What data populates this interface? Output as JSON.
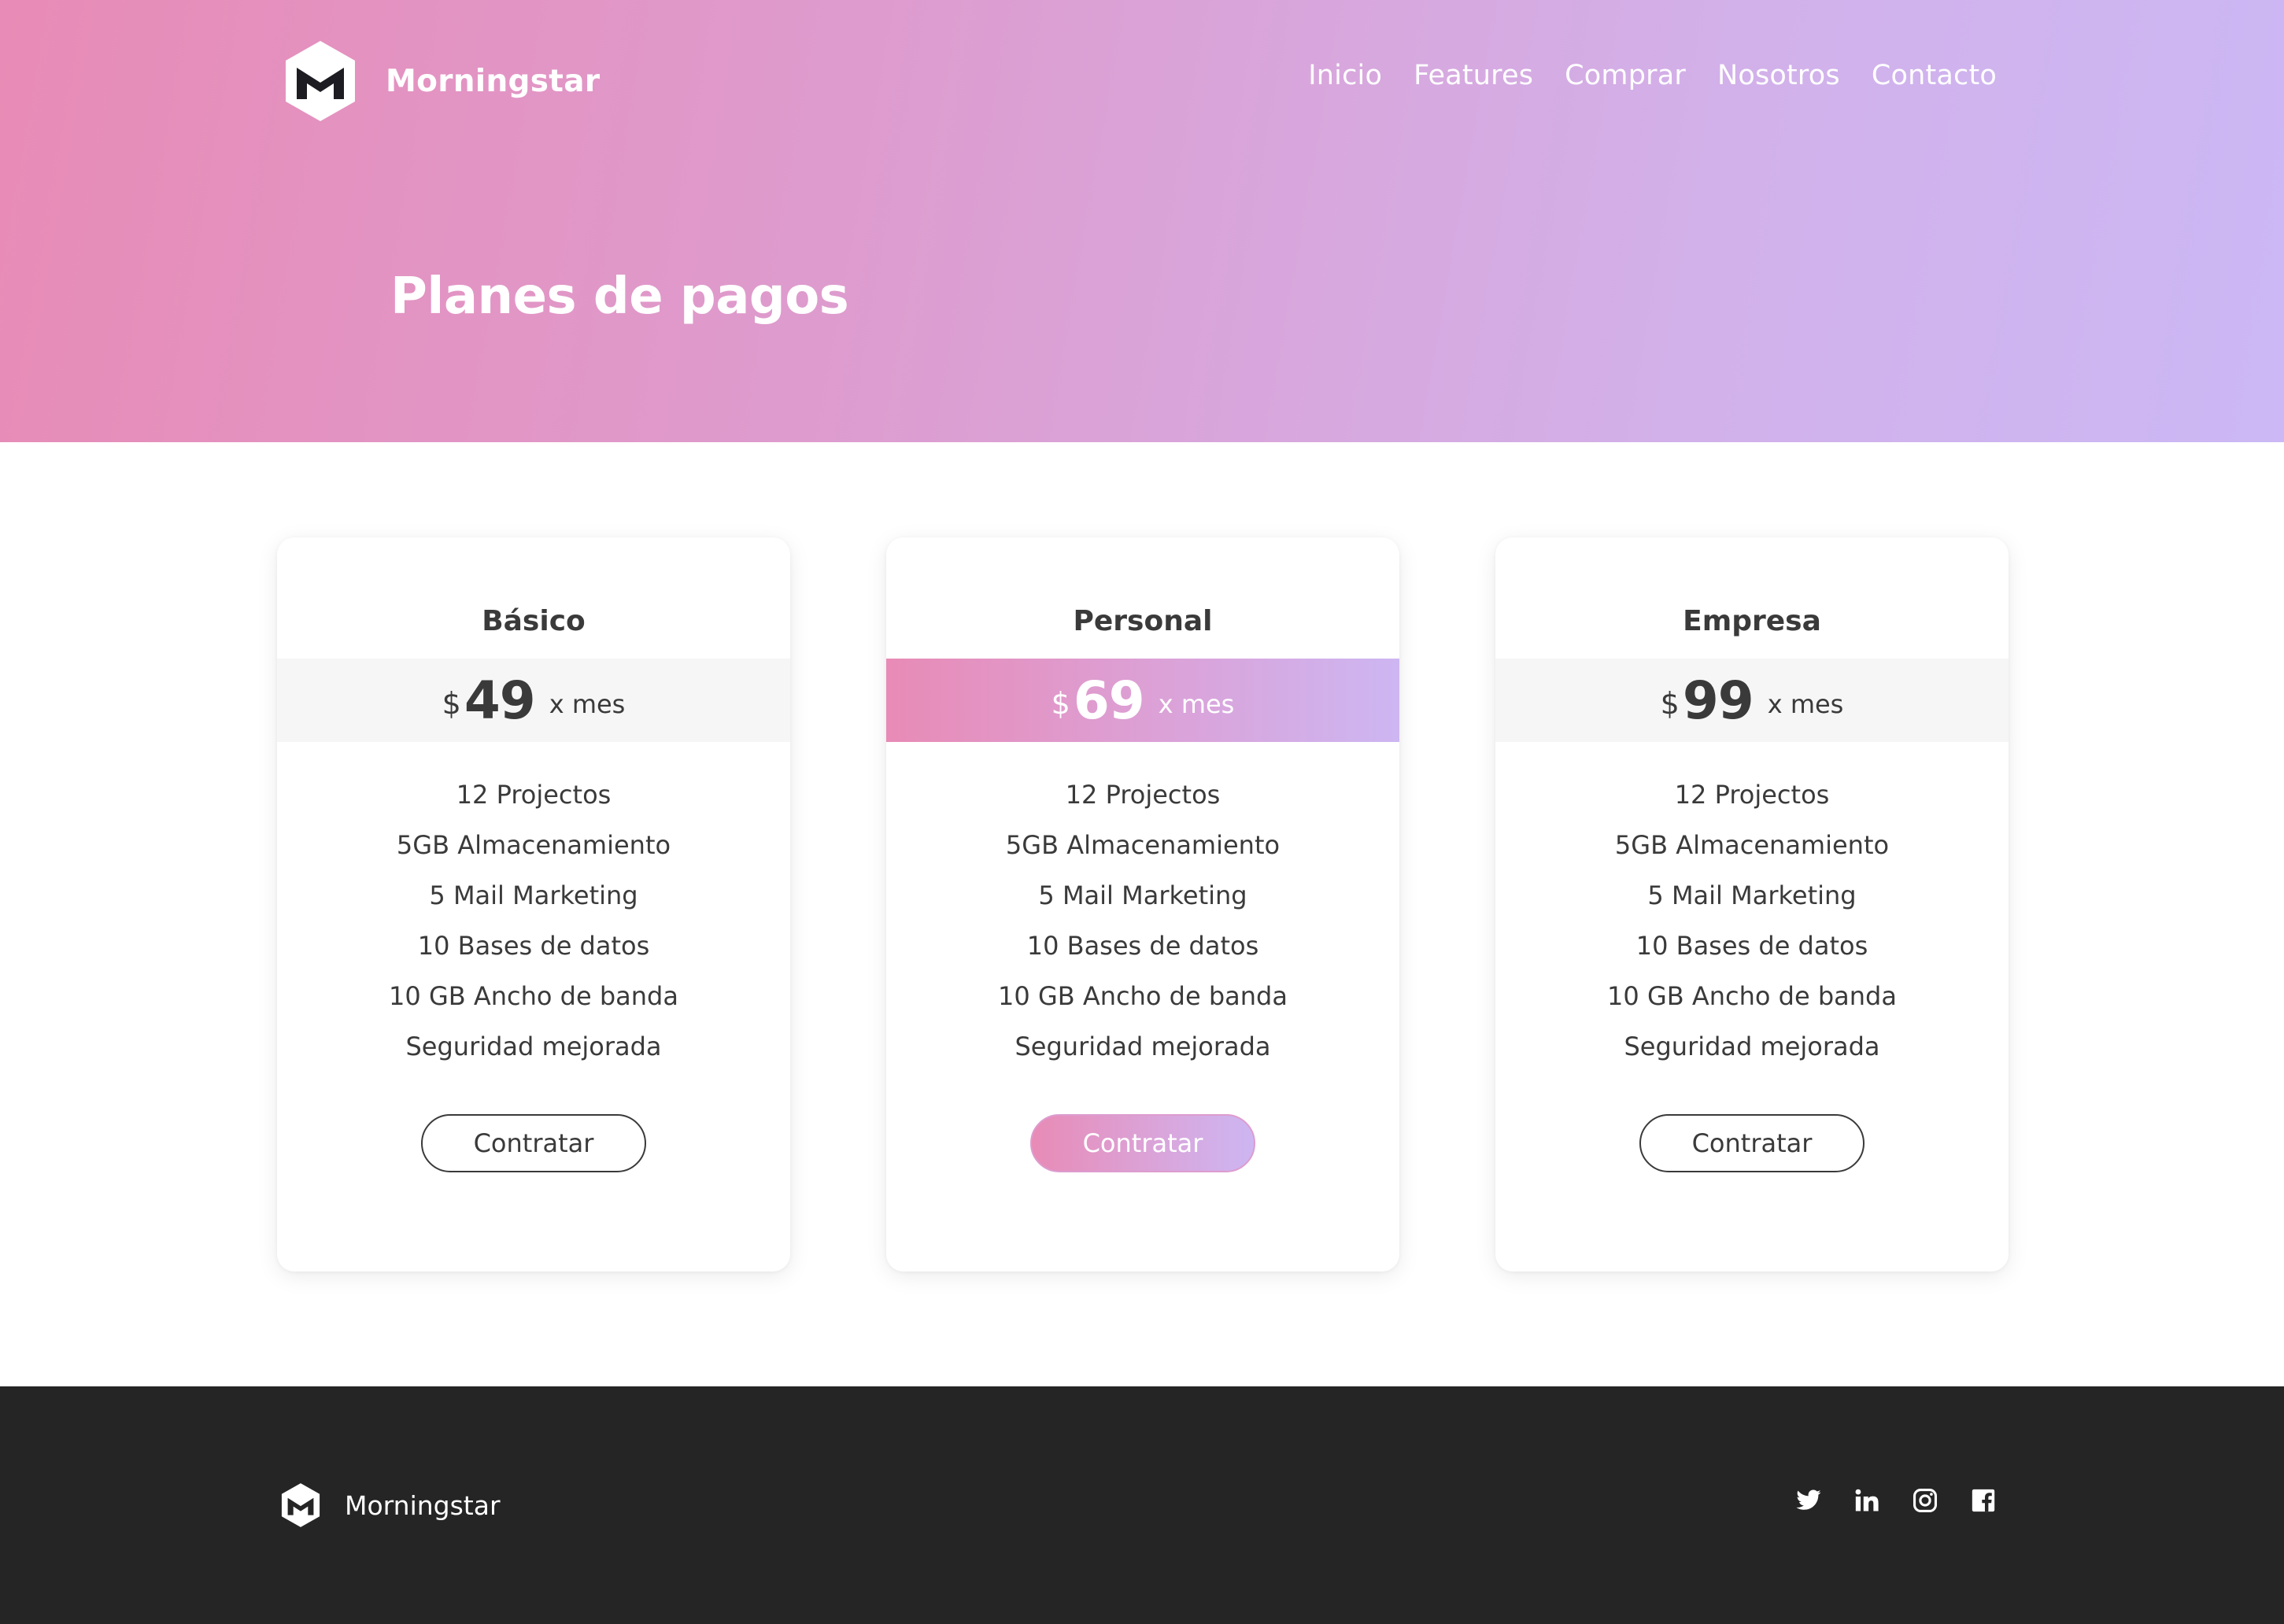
{
  "brand": {
    "name": "Morningstar"
  },
  "nav": {
    "items": [
      "Inicio",
      "Features",
      "Comprar",
      "Nosotros",
      "Contacto"
    ]
  },
  "hero": {
    "title": "Planes de pagos"
  },
  "plans": [
    {
      "name": "Básico",
      "currency": "$",
      "price": "49",
      "period": "x mes",
      "featured": false,
      "features": [
        "12 Projectos",
        "5GB Almacenamiento",
        "5 Mail Marketing",
        "10 Bases de datos",
        "10 GB Ancho de banda",
        "Seguridad mejorada"
      ],
      "button": "Contratar"
    },
    {
      "name": "Personal",
      "currency": "$",
      "price": "69",
      "period": "x mes",
      "featured": true,
      "features": [
        "12 Projectos",
        "5GB Almacenamiento",
        "5 Mail Marketing",
        "10 Bases de datos",
        "10 GB Ancho de banda",
        "Seguridad mejorada"
      ],
      "button": "Contratar"
    },
    {
      "name": "Empresa",
      "currency": "$",
      "price": "99",
      "period": "x mes",
      "featured": false,
      "features": [
        "12 Projectos",
        "5GB Almacenamiento",
        "5 Mail Marketing",
        "10 Bases de datos",
        "10 GB Ancho de banda",
        "Seguridad mejorada"
      ],
      "button": "Contratar"
    }
  ],
  "footer": {
    "brand": "Morningstar",
    "social": [
      "twitter-icon",
      "linkedin-icon",
      "instagram-icon",
      "facebook-icon"
    ]
  },
  "colors": {
    "gradient_start": "#e88bb6",
    "gradient_end": "#cbb8f5",
    "footer_bg": "#252525",
    "text_dark": "#3a3a3a"
  }
}
